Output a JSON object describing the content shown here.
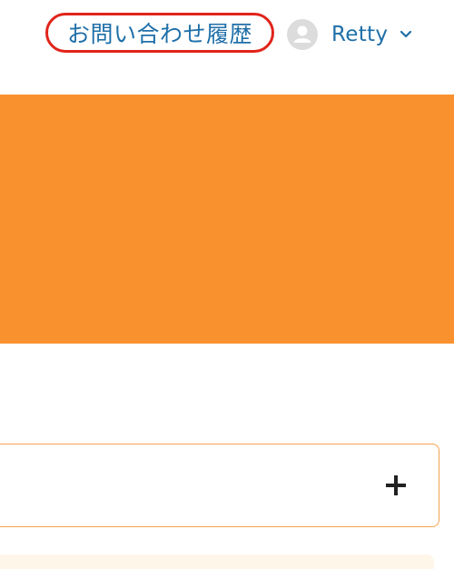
{
  "header": {
    "inquiry_history_label": "お問い合わせ履歴",
    "user_name": "Retty",
    "icons": {
      "avatar": "user-avatar-icon",
      "dropdown": "chevron-down-icon"
    }
  },
  "colors": {
    "link": "#1f6fa8",
    "highlight_ring": "#e0241b",
    "banner": "#f9922e",
    "accordion_border": "#f6a24d"
  },
  "accordion": {
    "expand_icon": "plus-icon"
  }
}
